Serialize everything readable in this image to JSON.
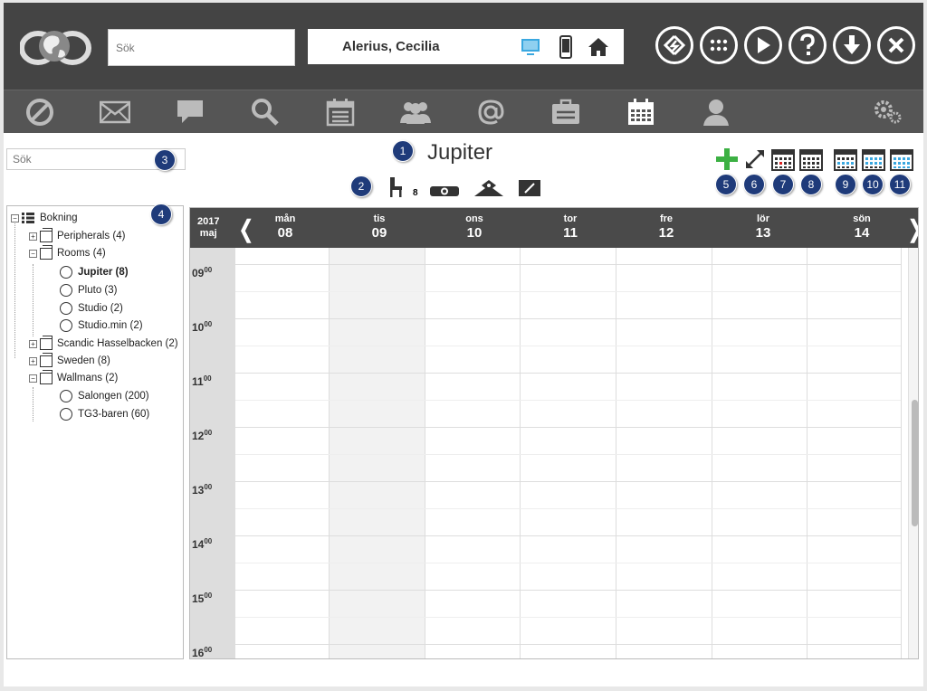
{
  "top": {
    "search_placeholder": "Sök",
    "user_name": "Alerius, Cecilia",
    "device_icons": [
      "desktop-icon",
      "mobile-icon",
      "home-icon"
    ],
    "action_buttons": [
      "sync-icon",
      "apps-icon",
      "play-icon",
      "help-icon",
      "download-icon",
      "close-icon"
    ]
  },
  "nav": {
    "items": [
      "block-icon",
      "mail-icon",
      "chat-icon",
      "search-icon",
      "calendar-list-icon",
      "group-icon",
      "at-icon",
      "card-icon",
      "calendar-icon",
      "person-icon",
      "settings-icon"
    ],
    "active": "calendar-icon"
  },
  "left": {
    "search_placeholder": "Sök",
    "tree": [
      {
        "label": "Bokning",
        "level": 0,
        "type": "root",
        "expander": "−"
      },
      {
        "label": "Peripherals (4)",
        "level": 1,
        "type": "folder",
        "expander": "+"
      },
      {
        "label": "Rooms (4)",
        "level": 1,
        "type": "folder",
        "expander": "−"
      },
      {
        "label": "Jupiter (8)",
        "level": 2,
        "type": "item",
        "selected": true
      },
      {
        "label": "Pluto (3)",
        "level": 2,
        "type": "item"
      },
      {
        "label": "Studio (2)",
        "level": 2,
        "type": "item"
      },
      {
        "label": "Studio.min (2)",
        "level": 2,
        "type": "item"
      },
      {
        "label": "Scandic Hasselbacken (2)",
        "level": 1,
        "type": "folder",
        "expander": "+"
      },
      {
        "label": "Sweden (8)",
        "level": 1,
        "type": "folder",
        "expander": "+"
      },
      {
        "label": "Wallmans (2)",
        "level": 1,
        "type": "folder",
        "expander": "−"
      },
      {
        "label": "Salongen (200)",
        "level": 2,
        "type": "item"
      },
      {
        "label": "TG3-baren (60)",
        "level": 2,
        "type": "item"
      }
    ]
  },
  "room": {
    "title": "Jupiter",
    "seats": "8",
    "resource_icons": [
      "chair-icon",
      "projector-icon",
      "video-conference-icon",
      "whiteboard-icon"
    ]
  },
  "badges": [
    "1",
    "2",
    "3",
    "4",
    "5",
    "6",
    "7",
    "8",
    "9",
    "10",
    "11"
  ],
  "toolbar": [
    "add-icon",
    "expand-icon",
    "day-view-icon",
    "workweek-view-icon",
    "week-view-icon",
    "two-week-view-icon",
    "month-view-icon"
  ],
  "calendar": {
    "year": "2017",
    "month": "maj",
    "prev": "❬",
    "next": "❭",
    "days": [
      {
        "name": "mån",
        "num": "08"
      },
      {
        "name": "tis",
        "num": "09"
      },
      {
        "name": "ons",
        "num": "10"
      },
      {
        "name": "tor",
        "num": "11"
      },
      {
        "name": "fre",
        "num": "12"
      },
      {
        "name": "lör",
        "num": "13"
      },
      {
        "name": "sön",
        "num": "14"
      }
    ],
    "hours": [
      "09",
      "10",
      "11",
      "12",
      "13",
      "14",
      "15",
      "16"
    ],
    "minutes": "00",
    "colors": {
      "header": "#4a4a4a",
      "highlight_col": "#f2f2f2",
      "badge": "#1f3b7a",
      "add": "#3cb043"
    }
  }
}
